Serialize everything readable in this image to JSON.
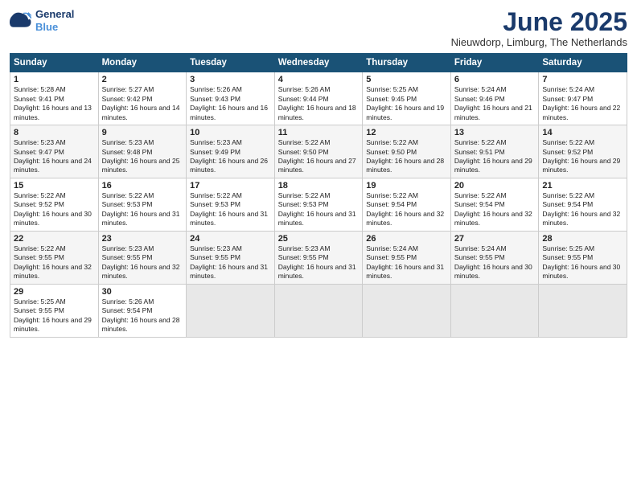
{
  "header": {
    "logo_line1": "General",
    "logo_line2": "Blue",
    "title": "June 2025",
    "location": "Nieuwdorp, Limburg, The Netherlands"
  },
  "days_of_week": [
    "Sunday",
    "Monday",
    "Tuesday",
    "Wednesday",
    "Thursday",
    "Friday",
    "Saturday"
  ],
  "weeks": [
    [
      {
        "num": "1",
        "sunrise": "Sunrise: 5:28 AM",
        "sunset": "Sunset: 9:41 PM",
        "daylight": "Daylight: 16 hours and 13 minutes."
      },
      {
        "num": "2",
        "sunrise": "Sunrise: 5:27 AM",
        "sunset": "Sunset: 9:42 PM",
        "daylight": "Daylight: 16 hours and 14 minutes."
      },
      {
        "num": "3",
        "sunrise": "Sunrise: 5:26 AM",
        "sunset": "Sunset: 9:43 PM",
        "daylight": "Daylight: 16 hours and 16 minutes."
      },
      {
        "num": "4",
        "sunrise": "Sunrise: 5:26 AM",
        "sunset": "Sunset: 9:44 PM",
        "daylight": "Daylight: 16 hours and 18 minutes."
      },
      {
        "num": "5",
        "sunrise": "Sunrise: 5:25 AM",
        "sunset": "Sunset: 9:45 PM",
        "daylight": "Daylight: 16 hours and 19 minutes."
      },
      {
        "num": "6",
        "sunrise": "Sunrise: 5:24 AM",
        "sunset": "Sunset: 9:46 PM",
        "daylight": "Daylight: 16 hours and 21 minutes."
      },
      {
        "num": "7",
        "sunrise": "Sunrise: 5:24 AM",
        "sunset": "Sunset: 9:47 PM",
        "daylight": "Daylight: 16 hours and 22 minutes."
      }
    ],
    [
      {
        "num": "8",
        "sunrise": "Sunrise: 5:23 AM",
        "sunset": "Sunset: 9:47 PM",
        "daylight": "Daylight: 16 hours and 24 minutes."
      },
      {
        "num": "9",
        "sunrise": "Sunrise: 5:23 AM",
        "sunset": "Sunset: 9:48 PM",
        "daylight": "Daylight: 16 hours and 25 minutes."
      },
      {
        "num": "10",
        "sunrise": "Sunrise: 5:23 AM",
        "sunset": "Sunset: 9:49 PM",
        "daylight": "Daylight: 16 hours and 26 minutes."
      },
      {
        "num": "11",
        "sunrise": "Sunrise: 5:22 AM",
        "sunset": "Sunset: 9:50 PM",
        "daylight": "Daylight: 16 hours and 27 minutes."
      },
      {
        "num": "12",
        "sunrise": "Sunrise: 5:22 AM",
        "sunset": "Sunset: 9:50 PM",
        "daylight": "Daylight: 16 hours and 28 minutes."
      },
      {
        "num": "13",
        "sunrise": "Sunrise: 5:22 AM",
        "sunset": "Sunset: 9:51 PM",
        "daylight": "Daylight: 16 hours and 29 minutes."
      },
      {
        "num": "14",
        "sunrise": "Sunrise: 5:22 AM",
        "sunset": "Sunset: 9:52 PM",
        "daylight": "Daylight: 16 hours and 29 minutes."
      }
    ],
    [
      {
        "num": "15",
        "sunrise": "Sunrise: 5:22 AM",
        "sunset": "Sunset: 9:52 PM",
        "daylight": "Daylight: 16 hours and 30 minutes."
      },
      {
        "num": "16",
        "sunrise": "Sunrise: 5:22 AM",
        "sunset": "Sunset: 9:53 PM",
        "daylight": "Daylight: 16 hours and 31 minutes."
      },
      {
        "num": "17",
        "sunrise": "Sunrise: 5:22 AM",
        "sunset": "Sunset: 9:53 PM",
        "daylight": "Daylight: 16 hours and 31 minutes."
      },
      {
        "num": "18",
        "sunrise": "Sunrise: 5:22 AM",
        "sunset": "Sunset: 9:53 PM",
        "daylight": "Daylight: 16 hours and 31 minutes."
      },
      {
        "num": "19",
        "sunrise": "Sunrise: 5:22 AM",
        "sunset": "Sunset: 9:54 PM",
        "daylight": "Daylight: 16 hours and 32 minutes."
      },
      {
        "num": "20",
        "sunrise": "Sunrise: 5:22 AM",
        "sunset": "Sunset: 9:54 PM",
        "daylight": "Daylight: 16 hours and 32 minutes."
      },
      {
        "num": "21",
        "sunrise": "Sunrise: 5:22 AM",
        "sunset": "Sunset: 9:54 PM",
        "daylight": "Daylight: 16 hours and 32 minutes."
      }
    ],
    [
      {
        "num": "22",
        "sunrise": "Sunrise: 5:22 AM",
        "sunset": "Sunset: 9:55 PM",
        "daylight": "Daylight: 16 hours and 32 minutes."
      },
      {
        "num": "23",
        "sunrise": "Sunrise: 5:23 AM",
        "sunset": "Sunset: 9:55 PM",
        "daylight": "Daylight: 16 hours and 32 minutes."
      },
      {
        "num": "24",
        "sunrise": "Sunrise: 5:23 AM",
        "sunset": "Sunset: 9:55 PM",
        "daylight": "Daylight: 16 hours and 31 minutes."
      },
      {
        "num": "25",
        "sunrise": "Sunrise: 5:23 AM",
        "sunset": "Sunset: 9:55 PM",
        "daylight": "Daylight: 16 hours and 31 minutes."
      },
      {
        "num": "26",
        "sunrise": "Sunrise: 5:24 AM",
        "sunset": "Sunset: 9:55 PM",
        "daylight": "Daylight: 16 hours and 31 minutes."
      },
      {
        "num": "27",
        "sunrise": "Sunrise: 5:24 AM",
        "sunset": "Sunset: 9:55 PM",
        "daylight": "Daylight: 16 hours and 30 minutes."
      },
      {
        "num": "28",
        "sunrise": "Sunrise: 5:25 AM",
        "sunset": "Sunset: 9:55 PM",
        "daylight": "Daylight: 16 hours and 30 minutes."
      }
    ],
    [
      {
        "num": "29",
        "sunrise": "Sunrise: 5:25 AM",
        "sunset": "Sunset: 9:55 PM",
        "daylight": "Daylight: 16 hours and 29 minutes."
      },
      {
        "num": "30",
        "sunrise": "Sunrise: 5:26 AM",
        "sunset": "Sunset: 9:54 PM",
        "daylight": "Daylight: 16 hours and 28 minutes."
      },
      null,
      null,
      null,
      null,
      null
    ]
  ]
}
